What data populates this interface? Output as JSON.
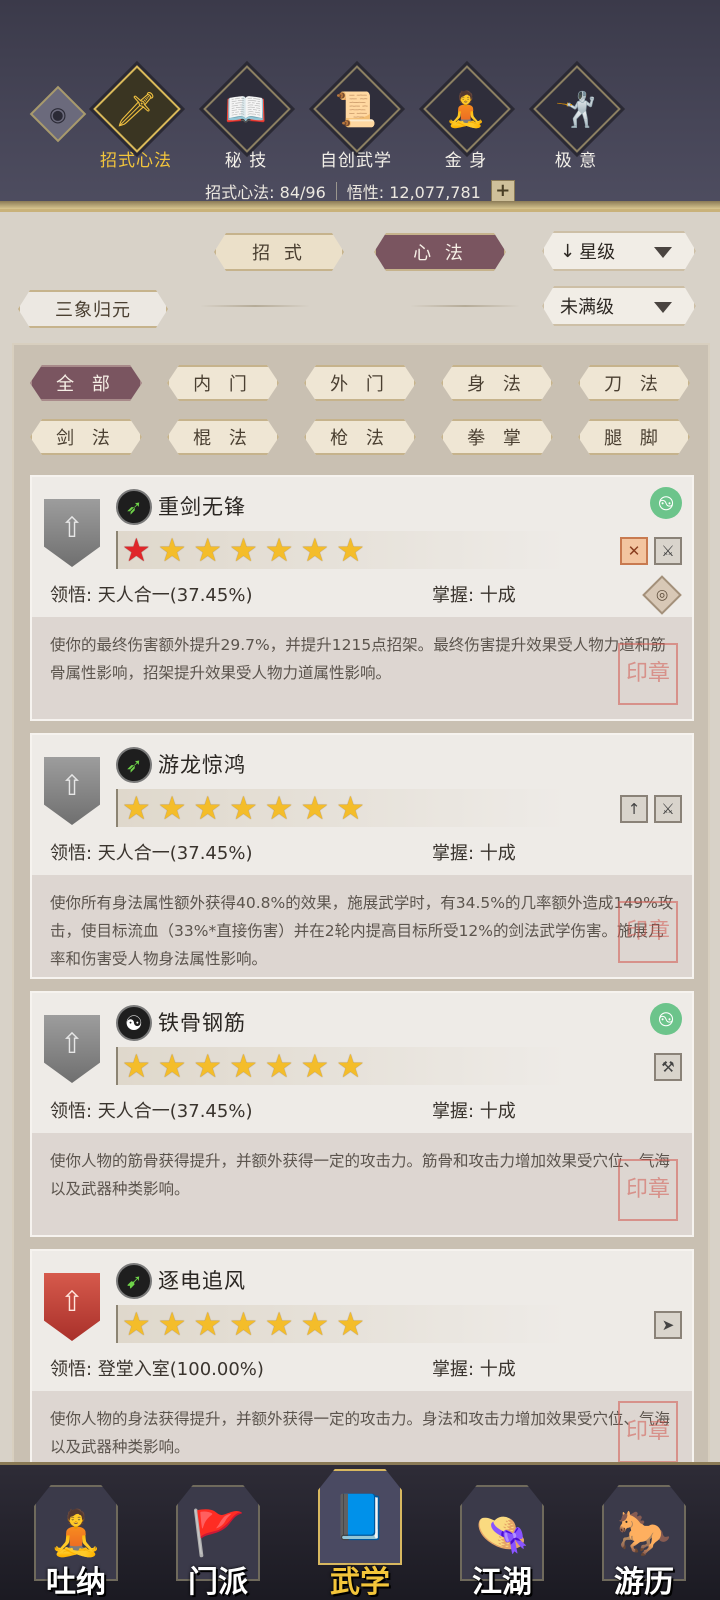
{
  "header": {
    "categories": [
      {
        "label": "招式心法",
        "icon": "sword-icon"
      },
      {
        "label": "秘 技",
        "icon": "book-icon"
      },
      {
        "label": "自创武学",
        "icon": "scroll-icon"
      },
      {
        "label": "金 身",
        "icon": "meditation-icon"
      },
      {
        "label": "极 意",
        "icon": "fighter-icon"
      }
    ],
    "stats": {
      "skills": "招式心法: 84/96",
      "insight": "悟性: 12,077,781"
    }
  },
  "controls": {
    "tab_moves": "招 式",
    "tab_mind": "心 法",
    "sort": "星级",
    "sort_arrow": "↓",
    "filter_status": "未满级",
    "set_name": "三象归元"
  },
  "filters": [
    "全 部",
    "内 门",
    "外 门",
    "身 法",
    "刀 法",
    "剑 法",
    "棍 法",
    "枪 法",
    "拳 掌",
    "腿 脚"
  ],
  "skills": [
    {
      "name": "重剑无锋",
      "stars": 7,
      "red_stars": 1,
      "insight": "领悟: 天人合一(37.45%)",
      "mastery": "掌握: 十成",
      "description": "使你的最终伤害额外提升29.7%，并提升1215点招架。最终伤害提升效果受人物力道和筋骨属性影响，招架提升效果受人物力道属性影响。"
    },
    {
      "name": "游龙惊鸿",
      "stars": 7,
      "red_stars": 0,
      "insight": "领悟: 天人合一(37.45%)",
      "mastery": "掌握: 十成",
      "description": "使你所有身法属性额外获得40.8%的效果，施展武学时，有34.5%的几率额外造成149%攻击，使目标流血（33%*直接伤害）并在2轮内提高目标所受12%的剑法武学伤害。施展几率和伤害受人物身法属性影响。"
    },
    {
      "name": "铁骨钢筋",
      "stars": 7,
      "red_stars": 0,
      "insight": "领悟: 天人合一(37.45%)",
      "mastery": "掌握: 十成",
      "description": "使你人物的筋骨获得提升，并额外获得一定的攻击力。筋骨和攻击力增加效果受穴位、气海以及武器种类影响。"
    },
    {
      "name": "逐电追风",
      "stars": 7,
      "red_stars": 0,
      "insight": "领悟: 登堂入室(100.00%)",
      "mastery": "掌握: 十成",
      "description": "使你人物的身法获得提升，并额外获得一定的攻击力。身法和攻击力增加效果受穴位、气海以及武器种类影响。"
    }
  ],
  "nav": [
    {
      "label": "吐纳",
      "icon": "monk-icon"
    },
    {
      "label": "门派",
      "icon": "banner-icon"
    },
    {
      "label": "武学",
      "icon": "manual-icon"
    },
    {
      "label": "江湖",
      "icon": "straw-hat-icon"
    },
    {
      "label": "游历",
      "icon": "horse-icon"
    }
  ],
  "colors": {
    "header_bg": "#474658",
    "accent_gold": "#f2c53c",
    "active_tab": "#7a5560",
    "star": "#f4bd2a",
    "star_red": "#e0262a"
  }
}
